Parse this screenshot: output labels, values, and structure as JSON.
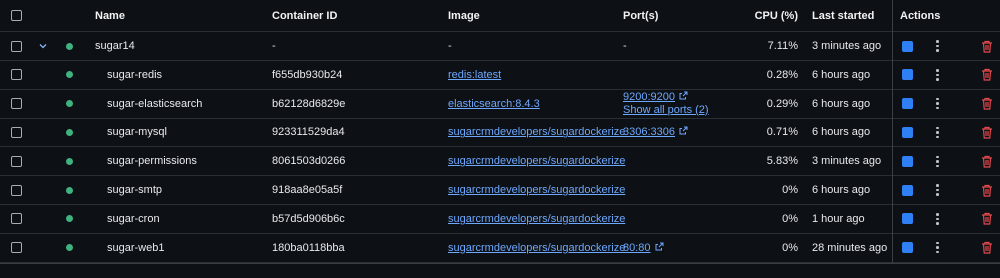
{
  "header": {
    "name": "Name",
    "container_id": "Container ID",
    "image": "Image",
    "ports": "Port(s)",
    "cpu": "CPU (%)",
    "last_started": "Last started",
    "actions": "Actions"
  },
  "group": {
    "name": "sugar14",
    "container_id": "-",
    "image": "-",
    "ports": "-",
    "cpu": "7.11%",
    "last_started": "3 minutes ago"
  },
  "containers": [
    {
      "name": "sugar-redis",
      "container_id": "f655db930b24",
      "image": "redis:latest",
      "port": "",
      "show_all": "",
      "cpu": "0.28%",
      "last_started": "6 hours ago"
    },
    {
      "name": "sugar-elasticsearch",
      "container_id": "b62128d6829e",
      "image": "elasticsearch:8.4.3",
      "port": "9200:9200",
      "show_all": "Show all ports (2)",
      "cpu": "0.29%",
      "last_started": "6 hours ago"
    },
    {
      "name": "sugar-mysql",
      "container_id": "923311529da4",
      "image": "sugarcrmdevelopers/sugardockerize",
      "port": "3306:3306",
      "show_all": "",
      "cpu": "0.71%",
      "last_started": "6 hours ago"
    },
    {
      "name": "sugar-permissions",
      "container_id": "8061503d0266",
      "image": "sugarcrmdevelopers/sugardockerize",
      "port": "",
      "show_all": "",
      "cpu": "5.83%",
      "last_started": "3 minutes ago"
    },
    {
      "name": "sugar-smtp",
      "container_id": "918aa8e05a5f",
      "image": "sugarcrmdevelopers/sugardockerize",
      "port": "",
      "show_all": "",
      "cpu": "0%",
      "last_started": "6 hours ago"
    },
    {
      "name": "sugar-cron",
      "container_id": "b57d5d906b6c",
      "image": "sugarcrmdevelopers/sugardockerize",
      "port": "",
      "show_all": "",
      "cpu": "0%",
      "last_started": "1 hour ago"
    },
    {
      "name": "sugar-web1",
      "container_id": "180ba0118bba",
      "image": "sugarcrmdevelopers/sugardockerize",
      "port": "80:80",
      "show_all": "",
      "cpu": "0%",
      "last_started": "28 minutes ago"
    }
  ],
  "colors": {
    "running": "#3fb27f",
    "link": "#6ea8fe",
    "stop": "#2f7ff5",
    "delete": "#e5484d"
  },
  "icons": {
    "expand": "chevron-down-icon",
    "status": "running-status-dot",
    "stop": "stop-icon",
    "more": "kebab-menu-icon",
    "delete": "trash-icon",
    "open": "external-link-icon"
  }
}
